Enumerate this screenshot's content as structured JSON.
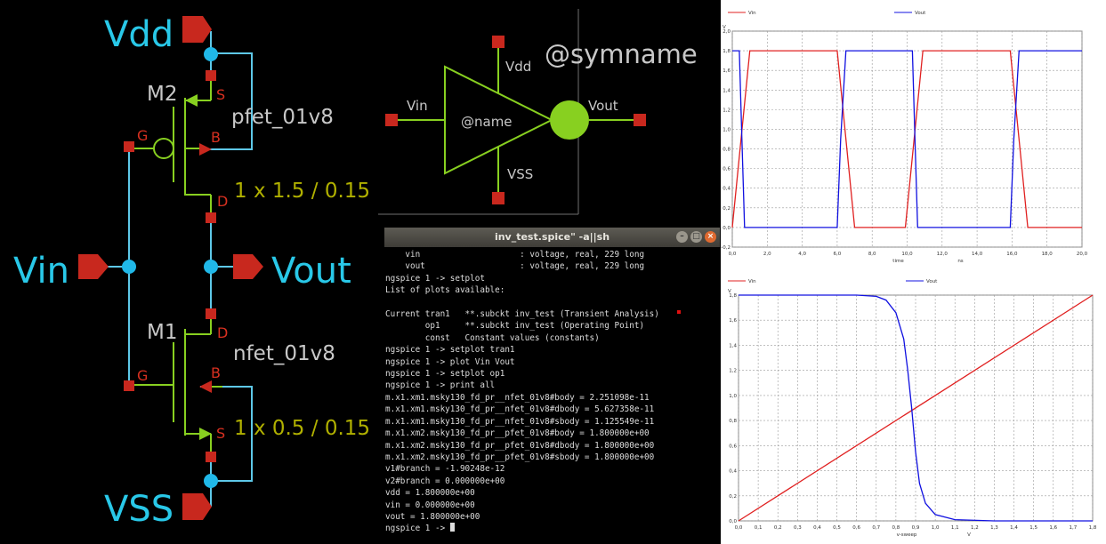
{
  "schematic": {
    "vdd": "Vdd",
    "vss": "VSS",
    "vin": "Vin",
    "vout": "Vout",
    "m2": "M2",
    "m1": "M1",
    "pfet_model": "pfet_01v8",
    "nfet_model": "nfet_01v8",
    "pfet_size": "1 x 1.5 / 0.15",
    "nfet_size": "1 x 0.5 / 0.15",
    "pins": {
      "s": "S",
      "g": "G",
      "b": "B",
      "d": "D"
    },
    "colors": {
      "wire": "#5ec8e8",
      "device": "#88d020",
      "pin": "#c8281e",
      "label": "#29c8e8",
      "size": "#b0b000"
    }
  },
  "symbol": {
    "symname": "@symname",
    "name": "@name",
    "vin": "Vin",
    "vout": "Vout",
    "vdd": "Vdd",
    "vss": "VSS"
  },
  "terminal": {
    "title": "inv_test.spice\" -a||sh",
    "lines": [
      "    vin                    : voltage, real, 229 long",
      "    vout                   : voltage, real, 229 long",
      "ngspice 1 -> setplot",
      "List of plots available:",
      "",
      "Current tran1   **.subckt inv_test (Transient Analysis)",
      "        op1     **.subckt inv_test (Operating Point)",
      "        const   Constant values (constants)",
      "ngspice 1 -> setplot tran1",
      "ngspice 1 -> plot Vin Vout",
      "ngspice 1 -> setplot op1",
      "ngspice 1 -> print all",
      "m.x1.xm1.msky130_fd_pr__nfet_01v8#body = 2.251098e-11",
      "m.x1.xm1.msky130_fd_pr__nfet_01v8#dbody = 5.627358e-11",
      "m.x1.xm1.msky130_fd_pr__nfet_01v8#sbody = 1.125549e-11",
      "m.x1.xm2.msky130_fd_pr__pfet_01v8#body = 1.800000e+00",
      "m.x1.xm2.msky130_fd_pr__pfet_01v8#dbody = 1.800000e+00",
      "m.x1.xm2.msky130_fd_pr__pfet_01v8#sbody = 1.800000e+00",
      "v1#branch = -1.90248e-12",
      "v2#branch = 0.000000e+00",
      "vdd = 1.800000e+00",
      "vin = 0.000000e+00",
      "vout = 1.800000e+00"
    ],
    "prompt": "ngspice 1 -> "
  },
  "chart_data": [
    {
      "type": "line",
      "ylabel": "V",
      "xlabel": "time",
      "xunit": "ns",
      "xlim": [
        0,
        20
      ],
      "ylim": [
        -0.2,
        2.0
      ],
      "xticks": [
        "0,0",
        "2,0",
        "4,0",
        "6,0",
        "8,0",
        "10,0",
        "12,0",
        "14,0",
        "16,0",
        "18,0",
        "20,0"
      ],
      "yticks": [
        "-0,2",
        "0,0",
        "0,2",
        "0,4",
        "0,6",
        "0,8",
        "1,0",
        "1,2",
        "1,4",
        "1,6",
        "1,8",
        "2,0"
      ],
      "series": [
        {
          "name": "Vin",
          "color": "#e02020",
          "x": [
            0,
            1,
            6,
            7,
            9.9,
            10.9,
            15.9,
            16.9,
            20
          ],
          "y": [
            0,
            1.8,
            1.8,
            0,
            0,
            1.8,
            1.8,
            0,
            0
          ]
        },
        {
          "name": "Vout",
          "color": "#1010e0",
          "x": [
            0,
            0.4,
            0.55,
            0.7,
            6,
            6.2,
            6.5,
            9.9,
            10.3,
            10.45,
            10.6,
            15.9,
            16.1,
            16.4,
            20
          ],
          "y": [
            1.8,
            1.8,
            0.9,
            0,
            0,
            0.9,
            1.8,
            1.8,
            1.8,
            0.9,
            0,
            0,
            0.9,
            1.8,
            1.8
          ]
        }
      ]
    },
    {
      "type": "line",
      "ylabel": "V",
      "xlabel": "v-sweep",
      "xunit": "V",
      "xlim": [
        0,
        1.8
      ],
      "ylim": [
        0,
        1.8
      ],
      "xticks": [
        "0,0",
        "0,1",
        "0,2",
        "0,3",
        "0,4",
        "0,5",
        "0,6",
        "0,7",
        "0,8",
        "0,9",
        "1,0",
        "1,1",
        "1,2",
        "1,3",
        "1,4",
        "1,5",
        "1,6",
        "1,7",
        "1,8"
      ],
      "yticks": [
        "0,0",
        "0,2",
        "0,4",
        "0,6",
        "0,8",
        "1,0",
        "1,2",
        "1,4",
        "1,6",
        "1,8"
      ],
      "series": [
        {
          "name": "Vin",
          "color": "#e02020",
          "x": [
            0,
            1.8
          ],
          "y": [
            0,
            1.8
          ]
        },
        {
          "name": "Vout",
          "color": "#1010e0",
          "x": [
            0,
            0.6,
            0.7,
            0.75,
            0.8,
            0.84,
            0.86,
            0.88,
            0.9,
            0.92,
            0.95,
            1.0,
            1.1,
            1.3,
            1.8
          ],
          "y": [
            1.8,
            1.8,
            1.79,
            1.76,
            1.66,
            1.45,
            1.2,
            0.9,
            0.55,
            0.3,
            0.14,
            0.05,
            0.01,
            0,
            0
          ]
        }
      ]
    }
  ]
}
